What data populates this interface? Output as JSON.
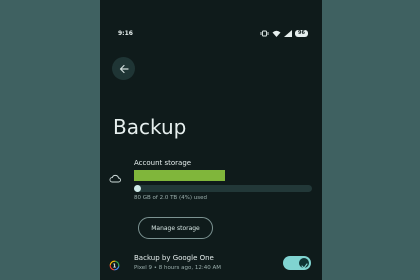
{
  "status_bar": {
    "time": "9:16",
    "battery": "96",
    "icons": [
      "vibrate-icon",
      "wifi-icon",
      "signal-icon"
    ]
  },
  "header": {
    "back_icon": "arrow-left-icon",
    "title": "Backup"
  },
  "account_storage": {
    "icon": "cloud-icon",
    "label": "Account storage",
    "usage_text": "80 GB of 2.0 TB (4%) used",
    "usage_fraction": 0.04,
    "manage_label": "Manage storage"
  },
  "google_one_backup": {
    "icon": "google-one-icon",
    "title": "Backup by Google One",
    "subtitle": "Pixel 9 • 8 hours ago, 12:40 AM",
    "enabled": true
  },
  "colors": {
    "background": "#3f6161",
    "screen": "#0f1b1b",
    "highlight": "#80b63b",
    "toggle_on": "#80d4d1"
  }
}
